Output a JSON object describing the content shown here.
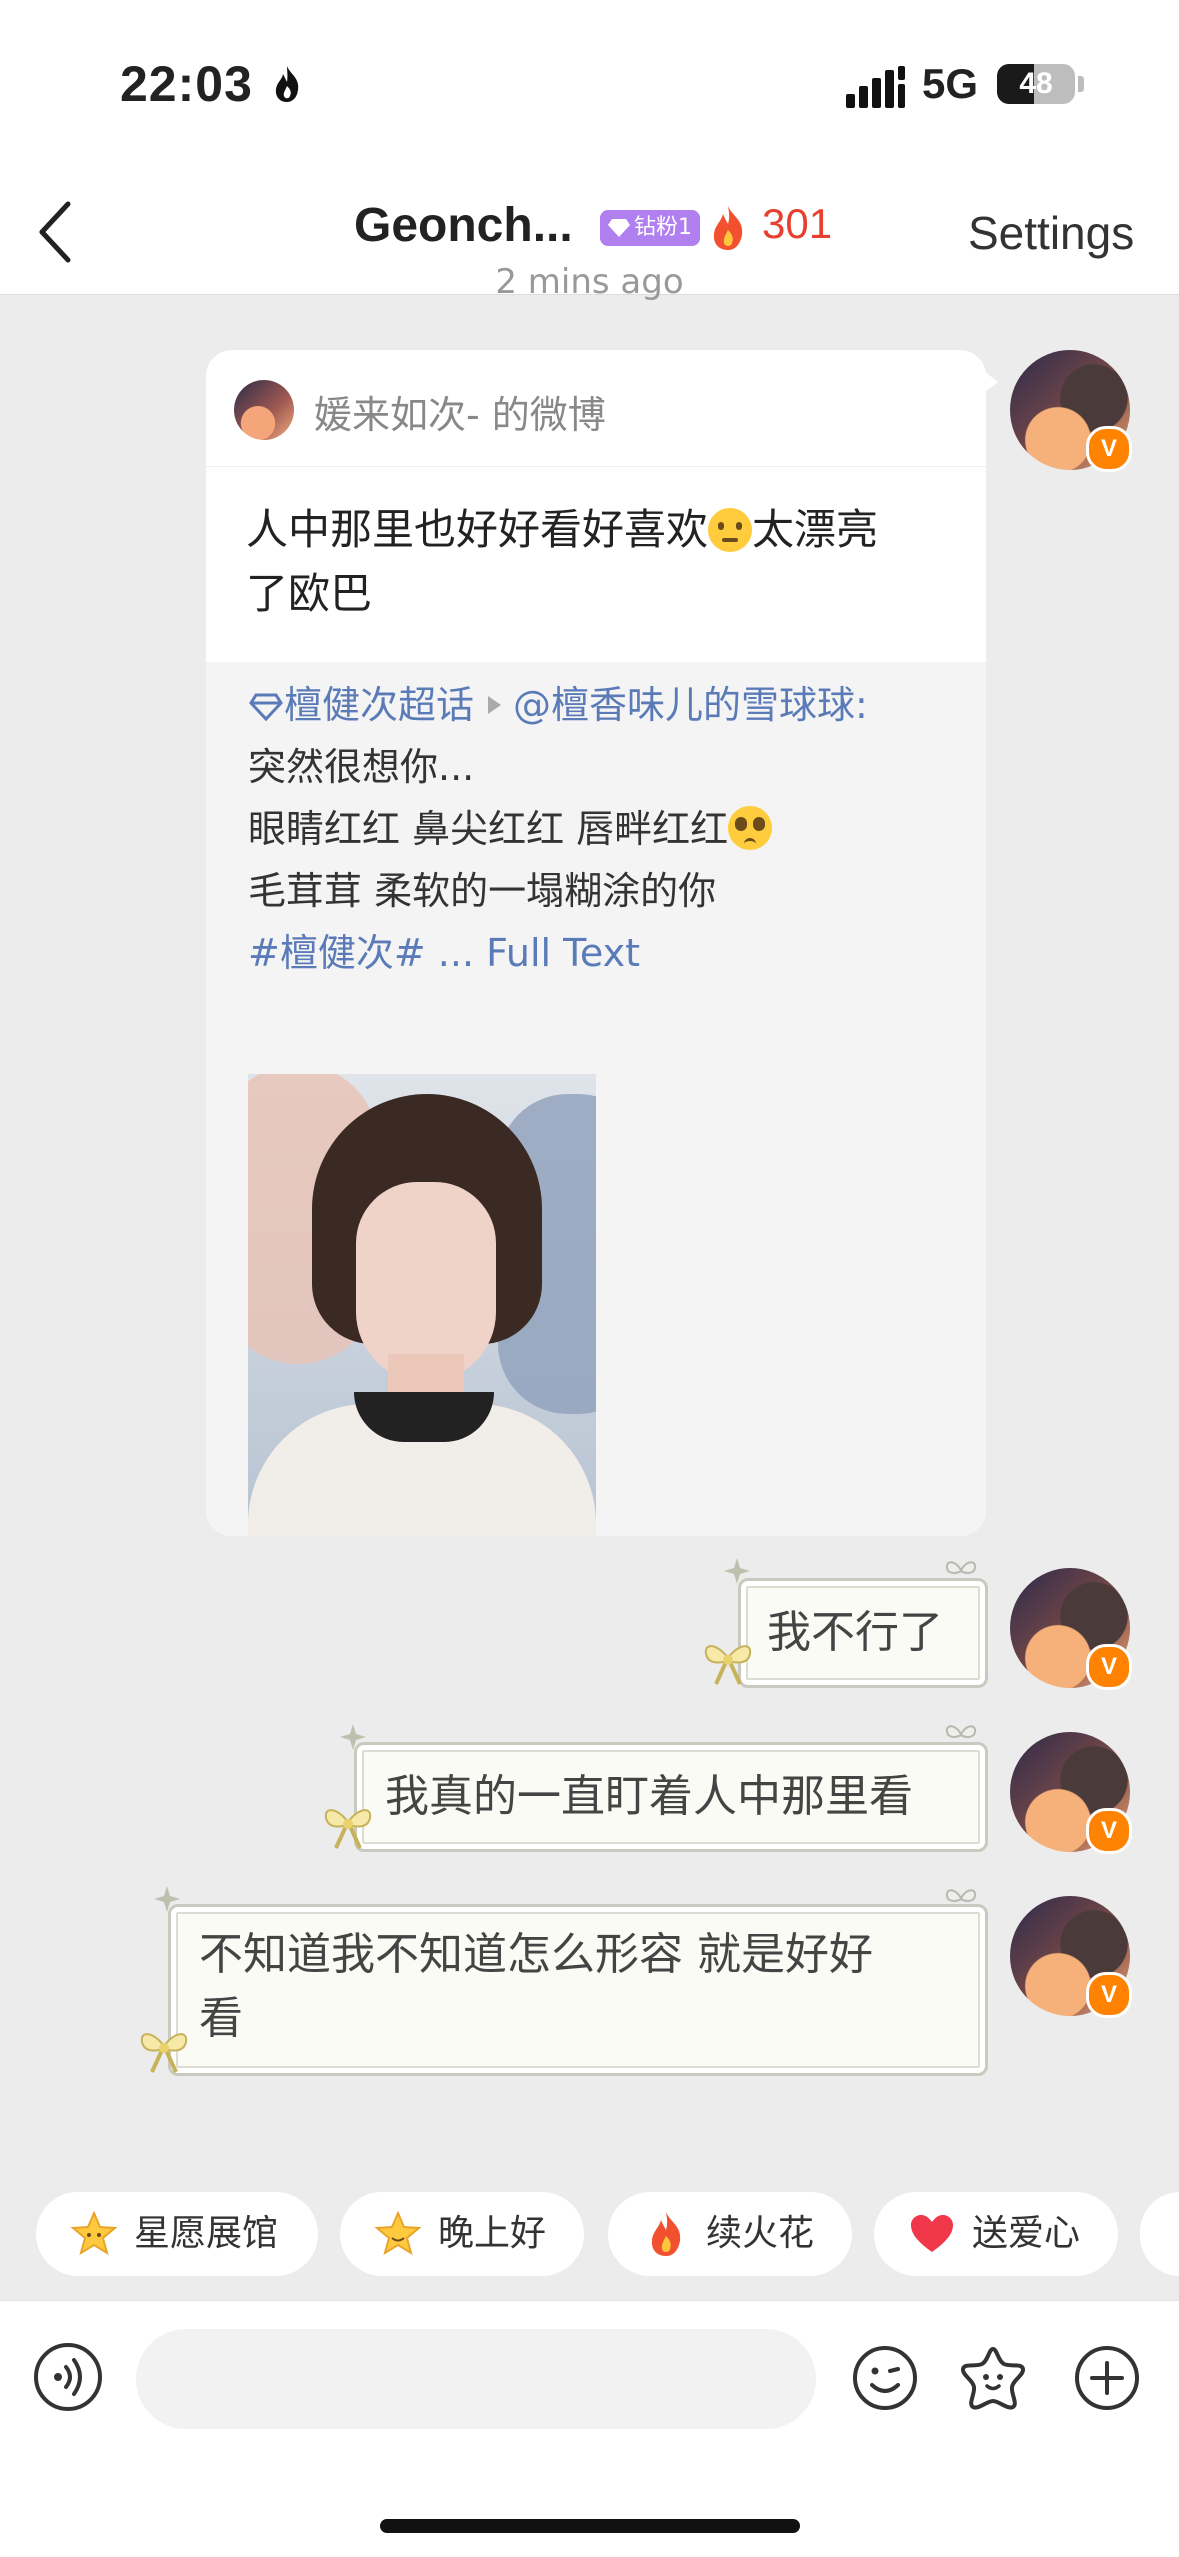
{
  "status_bar": {
    "time": "22:03",
    "network": "5G",
    "battery": "48",
    "battery_level": 0.48
  },
  "nav": {
    "title": "Geonch...",
    "fan_badge": "钻粉1",
    "fire_count": "301",
    "settings_label": "Settings"
  },
  "chat": {
    "timestamp": "2 mins ago",
    "shared_post": {
      "source": "媛来如次- 的微博",
      "comment_part1": "人中那里也好好看好喜欢",
      "comment_part2": "太漂亮",
      "comment_part3": "了欧巴",
      "quote_topic": "檀健次超话",
      "quote_user": "@檀香味儿的雪球球:",
      "quote_line1": "突然很想你...",
      "quote_line2": "眼睛红红 鼻尖红红 唇畔红红",
      "quote_line3": "毛茸茸 柔软的一塌糊涂的你",
      "quote_hashtag": "#檀健次#",
      "full_text_label": "... Full Text"
    },
    "messages": [
      {
        "text": "我不行了"
      },
      {
        "text": "我真的一直盯着人中那里看"
      },
      {
        "text_line1": "不知道我不知道怎么形容 就是好好",
        "text_line2": "看"
      }
    ]
  },
  "quick_actions": [
    {
      "label": "星愿展馆",
      "icon": "star-face-icon"
    },
    {
      "label": "晚上好",
      "icon": "star-smile-icon"
    },
    {
      "label": "续火花",
      "icon": "flame-icon"
    },
    {
      "label": "送爱心",
      "icon": "heart-icon"
    }
  ],
  "input_bar": {
    "placeholder": ""
  },
  "colors": {
    "accent_red": "#e8402f",
    "link_blue": "#5b7bb8",
    "fan_purple": "#b07ff0",
    "verified_orange": "#ff8200"
  }
}
